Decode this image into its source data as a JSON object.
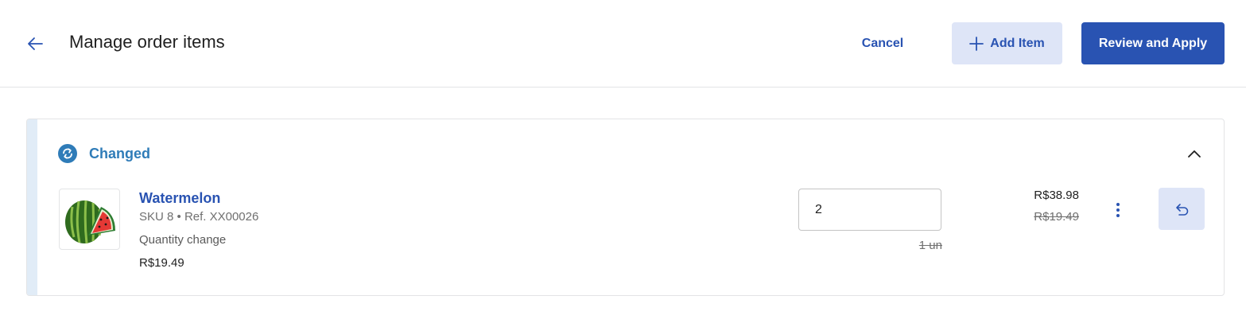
{
  "header": {
    "title": "Manage order items",
    "cancel_label": "Cancel",
    "add_item_label": "Add Item",
    "review_label": "Review and Apply"
  },
  "group": {
    "status_label": "Changed"
  },
  "item": {
    "name": "Watermelon",
    "sku_ref": "SKU 8 • Ref. XX00026",
    "change_type": "Quantity change",
    "unit_price": "R$19.49",
    "quantity": "2",
    "old_quantity": "1 un",
    "new_total": "R$38.98",
    "old_total": "R$19.49"
  },
  "colors": {
    "primary": "#2953b2",
    "primary_light": "#dee5f7",
    "changed": "#2f7cb8",
    "accent_bar": "#e1ecf7"
  },
  "icons": {
    "back": "arrow-left-icon",
    "add": "plus-icon",
    "status": "sync-icon",
    "collapse": "chevron-up-icon",
    "menu": "kebab-menu-icon",
    "undo": "undo-icon"
  }
}
